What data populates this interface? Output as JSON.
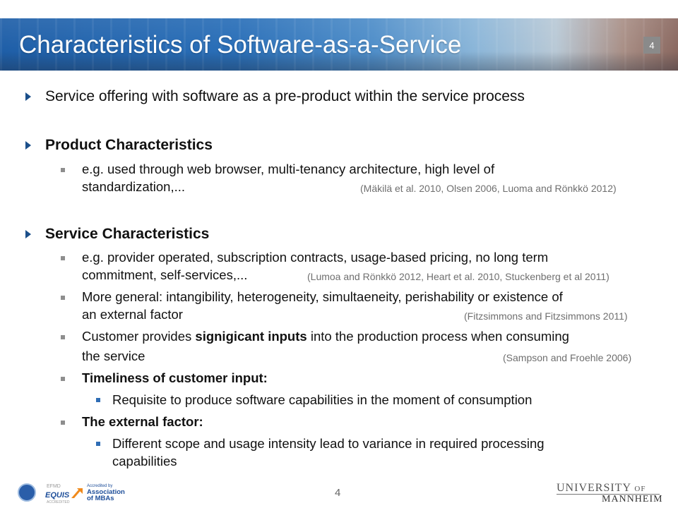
{
  "slide": {
    "title": "Characteristics of Software-as-a-Service",
    "number_badge": "4",
    "footer_number": "4"
  },
  "bullets": {
    "b1": "Service offering with software as a pre-product within the service process",
    "b2": "Product Characteristics",
    "b2_sub1_line1": "e.g. used through web browser, multi-tenancy architecture, high level of",
    "b2_sub1_line2": "standardization,...",
    "b2_sub1_cite": "(Mäkilä et al. 2010, Olsen 2006, Luoma and Rönkkö 2012)",
    "b3": "Service Characteristics",
    "b3_sub1_line1": "e.g. provider operated, subscription contracts, usage-based pricing, no long term",
    "b3_sub1_line2": "commitment, self-services,...",
    "b3_sub1_cite": "(Lumoa and Rönkkö 2012, Heart et al. 2010, Stuckenberg et al 2011)",
    "b3_sub2_line1": "More general: intangibility, heterogeneity, simultaeneity, perishability or existence of",
    "b3_sub2_line2": "an external factor",
    "b3_sub2_cite": "(Fitzsimmons and Fitzsimmons 2011)",
    "b3_sub3_pre": "Customer provides ",
    "b3_sub3_bold": "signigicant inputs",
    "b3_sub3_post": " into the production process when consuming",
    "b3_sub3_line2": "the service",
    "b3_sub3_cite": "(Sampson and Froehle 2006)",
    "b3_sub4": "Timeliness of customer input:",
    "b3_sub4_sub1": "Requisite to produce software capabilities in the moment of consumption",
    "b3_sub5": "The external factor:",
    "b3_sub5_sub1_line1": "Different scope and usage intensity lead to variance in required processing",
    "b3_sub5_sub1_line2": "capabilities"
  },
  "footer": {
    "equis_small": "EFMD",
    "equis": "EQUIS",
    "equis_sub": "ACCREDITED",
    "amba_small": "Accredited by",
    "amba_line1": "Association",
    "amba_line2": "of MBAs",
    "university_line1_a": "UNIVERSITY",
    "university_line1_b": "OF",
    "university_line2": "MANNHEIM"
  },
  "colors": {
    "header_blue": "#1f5fa8",
    "arrow_blue": "#1b4f8a",
    "sub_bullet_gray": "#8e8e8e",
    "subsub_bullet_blue": "#2f6db5",
    "citation_gray": "#6f6f6f"
  }
}
